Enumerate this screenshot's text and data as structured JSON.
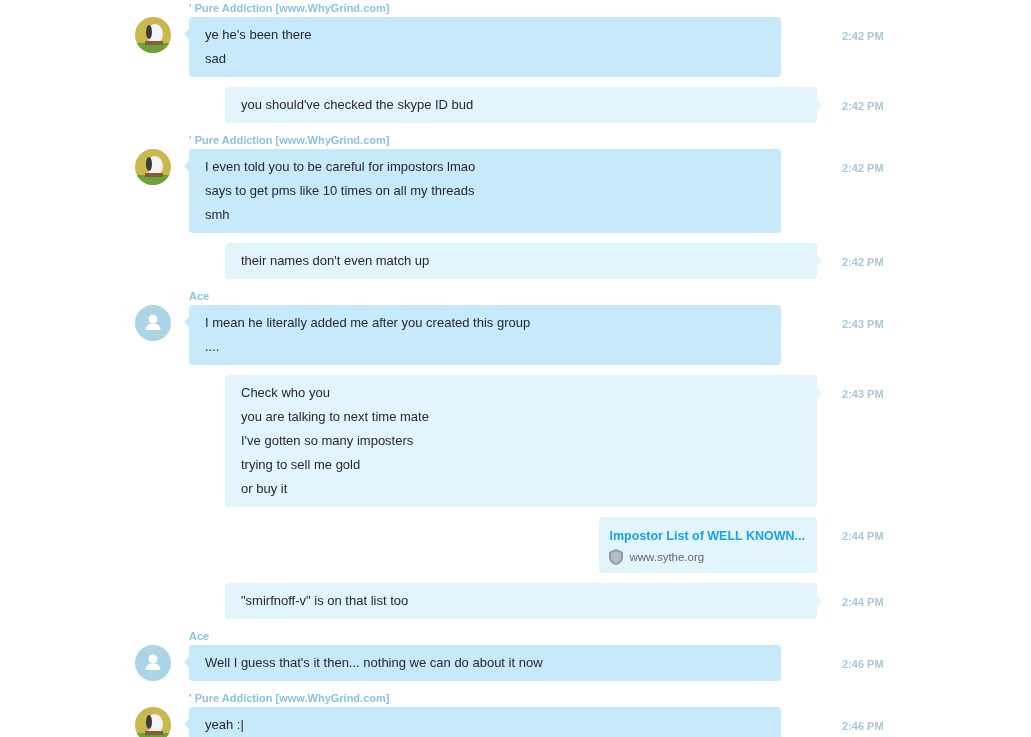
{
  "messages": [
    {
      "kind": "incoming",
      "sender": "' Pure Addiction [www.WhyGrind.com]",
      "avatar": {
        "kind": "picture"
      },
      "lines": [
        "ye he's been there",
        "sad"
      ],
      "time": "2:42 PM"
    },
    {
      "kind": "outgoing",
      "lines": [
        "you should've checked the skype ID bud"
      ],
      "time": "2:42 PM"
    },
    {
      "kind": "incoming",
      "sender": "' Pure Addiction [www.WhyGrind.com]",
      "avatar": {
        "kind": "picture"
      },
      "lines": [
        "I even told you to be careful for impostors lmao",
        "says to get pms like 10 times on all my threads",
        "smh"
      ],
      "time": "2:42 PM"
    },
    {
      "kind": "outgoing",
      "lines": [
        "their names don't even match up"
      ],
      "time": "2:42 PM"
    },
    {
      "kind": "incoming",
      "sender": "Ace",
      "avatar": {
        "kind": "default"
      },
      "lines": [
        "I mean he literally added me after you created this group",
        "...."
      ],
      "time": "2:43 PM"
    },
    {
      "kind": "outgoing",
      "lines": [
        "Check who you",
        "you are talking to next time mate",
        "I've gotten so many imposters",
        "trying to sell me gold",
        "or buy it"
      ],
      "time": "2:43 PM"
    },
    {
      "kind": "link",
      "title": "Impostor List of WELL KNOWN...",
      "domain": "www.sythe.org",
      "time": "2:44 PM"
    },
    {
      "kind": "outgoing",
      "lines": [
        "\"smirfnoff-v\" is on that list too"
      ],
      "time": "2:44 PM"
    },
    {
      "kind": "incoming",
      "sender": "Ace",
      "avatar": {
        "kind": "default"
      },
      "lines": [
        "Well I guess that's it then... nothing we can do about it now"
      ],
      "time": "2:46 PM"
    },
    {
      "kind": "incoming",
      "sender": "' Pure Addiction [www.WhyGrind.com]",
      "avatar": {
        "kind": "picture"
      },
      "lines": [
        "yeah :|"
      ],
      "time": "2:46 PM"
    }
  ]
}
